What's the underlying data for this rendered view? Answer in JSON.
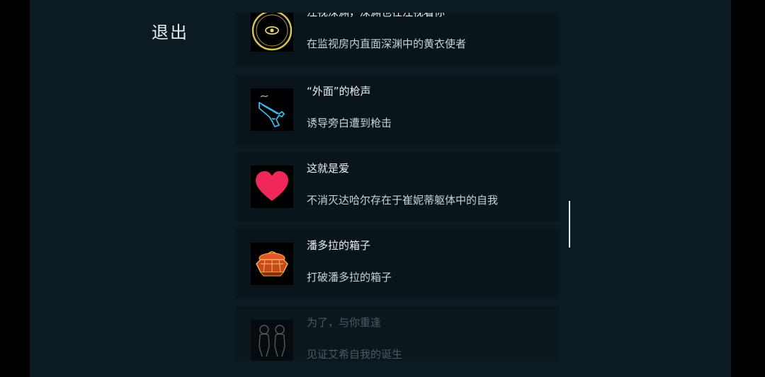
{
  "header": {
    "exit_label": "退出"
  },
  "achievements": [
    {
      "title": "注视深渊，深渊也在注视着你",
      "description": "在监视房内直面深渊中的黄衣使者",
      "icon": "eye-medallion-icon"
    },
    {
      "title": "“外面”的枪声",
      "description": "诱导旁白遭到枪击",
      "icon": "pistol-icon"
    },
    {
      "title": "这就是爱",
      "description": "不消灭达哈尔存在于崔妮蒂躯体中的自我",
      "icon": "heart-icon"
    },
    {
      "title": "潘多拉的箱子",
      "description": "打破潘多拉的箱子",
      "icon": "pandora-box-icon"
    },
    {
      "title": "为了，与你重逢",
      "description": "见证艾希自我的诞生",
      "icon": "twin-figures-icon",
      "locked": true
    }
  ],
  "colors": {
    "background": "#0c1a21",
    "card": "#0a151b",
    "text": "#ecf1f3",
    "heart": "#f0285a",
    "gold": "#d8c35a"
  }
}
